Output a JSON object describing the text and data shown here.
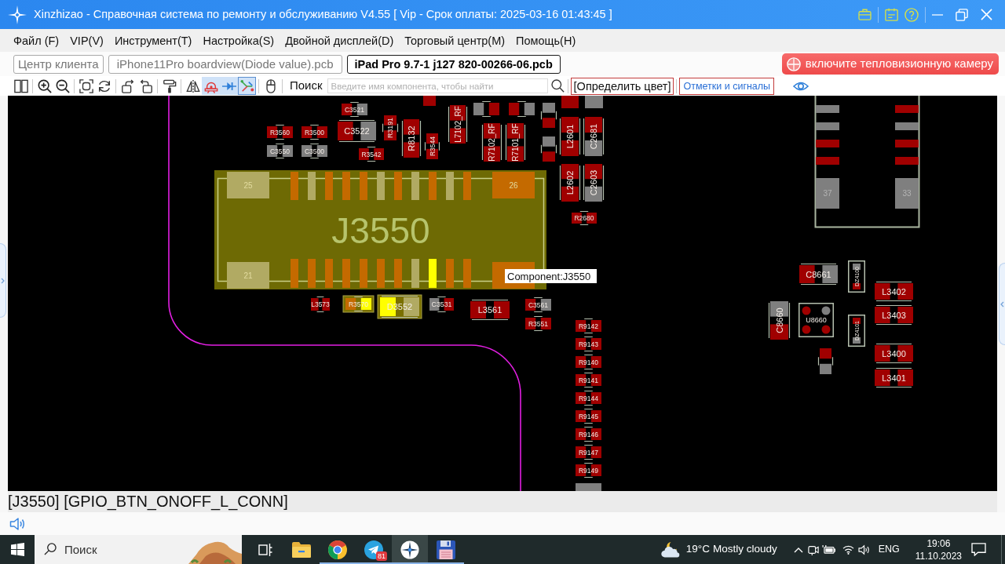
{
  "window": {
    "title": "Xinzhizao - Справочная система по ремонту и обслуживанию V4.55 [ Vip - Срок оплаты: 2025-03-16 01:43:45 ]"
  },
  "menu": [
    "Файл (F)",
    "VIP(V)",
    "Инструмент(T)",
    "Настройка(S)",
    "Двойной дисплей(D)",
    "Торговый центр(M)",
    "Помощь(H)"
  ],
  "tabs": [
    {
      "label": "Центр клиента",
      "selected": false
    },
    {
      "label": "iPhone11Pro boardview(Diode value).pcb",
      "selected": false
    },
    {
      "label": "iPad Pro 9.7-1 j127 820-00266-06.pcb",
      "selected": true
    }
  ],
  "thermal_button": "включите тепловизионную камеру",
  "toolbar": {
    "tools": [
      {
        "kind": "split",
        "active": false
      },
      {
        "kind": "zoom-in",
        "active": false
      },
      {
        "kind": "zoom-out",
        "active": false
      },
      {
        "kind": "fit",
        "active": false
      },
      {
        "kind": "refresh",
        "active": false
      },
      {
        "kind": "rotate-left",
        "active": false
      },
      {
        "kind": "rotate-right",
        "active": false
      },
      {
        "kind": "paint",
        "active": false
      },
      {
        "kind": "mirror",
        "active": false
      },
      {
        "kind": "alarm",
        "active": true
      },
      {
        "kind": "diode",
        "active": true
      },
      {
        "kind": "net",
        "active": true
      },
      {
        "kind": "mouse",
        "active": false
      }
    ],
    "search_label": "Поиск",
    "search": {
      "placeholder": "Введите имя компонента, чтобы найти"
    },
    "color_button": "[Определить цвет]",
    "marks_button": "Отметки и сигналы"
  },
  "board": {
    "connector": {
      "label": "J3550",
      "selected": true,
      "corner_pads": [
        {
          "label": "25",
          "color": "#b1aa63"
        },
        {
          "label": "26",
          "color": "#c46a00"
        },
        {
          "label": "21",
          "color": "#b1aa63"
        },
        {
          "color": "#c46a00"
        }
      ],
      "top_pins": [
        {
          "color": "#c46a00"
        },
        {
          "color": "#b1aa63"
        },
        {
          "color": "#c46a00"
        },
        {
          "color": "#c46a00"
        },
        {
          "color": "#c46a00"
        },
        {
          "color": "#b1aa63"
        },
        {
          "color": "#c46a00"
        },
        {
          "color": "#b1aa63"
        },
        {
          "color": "#c46a00"
        },
        {
          "color": "#b1aa63"
        },
        {
          "color": "#c46a00"
        }
      ],
      "bottom_pins": [
        {
          "color": "#c46a00"
        },
        {
          "color": "#c46a00"
        },
        {
          "color": "#c46a00"
        },
        {
          "color": "#c46a00"
        },
        {
          "color": "#c46a00"
        },
        {
          "color": "#c46a00"
        },
        {
          "color": "#c46a00"
        },
        {
          "color": "#b1aa63"
        },
        {
          "color": "#ffff00"
        },
        {
          "color": "#c46a00"
        },
        {
          "color": "#c46a00"
        }
      ]
    },
    "components": [
      {
        "kind": "two-pad",
        "highlighted": false,
        "pads": [
          {
            "color": "#a00000"
          }
        ]
      },
      {
        "kind": "two-pad",
        "label": "C3521",
        "highlighted": false,
        "pads": [
          {
            "color": "#a00000"
          },
          {
            "color": "#7f7f7f"
          }
        ]
      },
      {
        "kind": "two-pad",
        "label": "R3560",
        "highlighted": false,
        "pads": [
          {
            "color": "#a00000"
          },
          {
            "color": "#a00000"
          }
        ]
      },
      {
        "kind": "two-pad",
        "label": "R3500",
        "highlighted": false,
        "pads": [
          {
            "color": "#a00000"
          },
          {
            "color": "#a00000"
          }
        ]
      },
      {
        "kind": "two-pad",
        "label": "C3550",
        "highlighted": false,
        "pads": [
          {
            "color": "#7f7f7f"
          },
          {
            "color": "#7f7f7f"
          }
        ]
      },
      {
        "kind": "two-pad",
        "label": "C3500",
        "highlighted": false,
        "pads": [
          {
            "color": "#7f7f7f"
          },
          {
            "color": "#7f7f7f"
          }
        ]
      },
      {
        "kind": "two-pad",
        "label": "C3522",
        "highlighted": false,
        "pads": [
          {
            "color": "#a00000"
          },
          {
            "color": "#7f7f7f"
          }
        ]
      },
      {
        "kind": "two-pad",
        "label": "R3191",
        "highlighted": false,
        "pads": [
          {
            "color": "#a00000"
          },
          {
            "color": "#a00000"
          }
        ]
      },
      {
        "kind": "two-pad",
        "label": "R8132",
        "highlighted": false,
        "pads": [
          {
            "color": "#a00000"
          },
          {
            "color": "#a00000"
          }
        ]
      },
      {
        "kind": "two-pad",
        "label": "R3544",
        "highlighted": false,
        "pads": [
          {
            "color": "#a00000"
          },
          {
            "color": "#a00000"
          }
        ]
      },
      {
        "kind": "two-pad",
        "label": "R3542",
        "highlighted": false,
        "pads": [
          {
            "color": "#a00000"
          },
          {
            "color": "#a00000"
          }
        ]
      },
      {
        "kind": "two-pad",
        "label": "L7102_RF",
        "highlighted": false,
        "pads": [
          {
            "color": "#a00000"
          },
          {
            "color": "#a00000"
          }
        ]
      },
      {
        "kind": "two-pad",
        "highlighted": false,
        "pads": [
          {
            "color": "#7f7f7f"
          },
          {
            "color": "#a00000"
          }
        ]
      },
      {
        "kind": "two-pad",
        "highlighted": false,
        "pads": [
          {
            "color": "#a00000"
          },
          {
            "color": "#7f7f7f"
          }
        ]
      },
      {
        "kind": "two-pad",
        "label": "R7102_RF",
        "highlighted": false,
        "pads": [
          {
            "color": "#a00000"
          },
          {
            "color": "#a00000"
          }
        ]
      },
      {
        "kind": "two-pad",
        "label": "R7101_RF",
        "highlighted": false,
        "pads": [
          {
            "color": "#a00000"
          },
          {
            "color": "#a00000"
          }
        ]
      },
      {
        "kind": "two-pad",
        "highlighted": false,
        "pads": [
          {
            "color": "#7f7f7f"
          },
          {
            "color": "#a00000"
          }
        ]
      },
      {
        "kind": "two-pad",
        "highlighted": false,
        "pads": [
          {
            "color": "#7f7f7f"
          },
          {
            "color": "#a00000"
          }
        ]
      },
      {
        "kind": "two-pad",
        "highlighted": false,
        "pads": [
          {
            "color": "#a00000"
          }
        ]
      },
      {
        "kind": "two-pad",
        "highlighted": false,
        "pads": [
          {
            "color": "#7f7f7f"
          }
        ]
      },
      {
        "kind": "two-pad",
        "label": "L2601",
        "highlighted": false,
        "pads": [
          {
            "color": "#a00000"
          },
          {
            "color": "#a00000"
          }
        ]
      },
      {
        "kind": "two-pad",
        "label": "C2681",
        "highlighted": false,
        "pads": [
          {
            "color": "#a00000"
          },
          {
            "color": "#7f7f7f"
          }
        ]
      },
      {
        "kind": "two-pad",
        "label": "L2602",
        "highlighted": false,
        "pads": [
          {
            "color": "#a00000"
          },
          {
            "color": "#a00000"
          }
        ]
      },
      {
        "kind": "two-pad",
        "label": "C2603",
        "highlighted": false,
        "pads": [
          {
            "color": "#a00000"
          },
          {
            "color": "#7f7f7f"
          }
        ]
      },
      {
        "kind": "two-pad",
        "label": "R2680",
        "highlighted": false,
        "pads": [
          {
            "color": "#a00000"
          },
          {
            "color": "#a00000"
          }
        ]
      },
      {
        "kind": "two-pad",
        "label": "L3573",
        "highlighted": false,
        "pads": [
          {
            "color": "#a00000"
          },
          {
            "color": "#a00000"
          }
        ]
      },
      {
        "kind": "two-pad",
        "label": "R3570",
        "highlighted": true,
        "pads": [
          {
            "color": "#c46a00"
          },
          {
            "color": "#ffff00"
          }
        ]
      },
      {
        "kind": "two-pad",
        "label": "D3552",
        "highlighted": true,
        "pads": [
          {
            "color": "#ffff00"
          },
          {
            "color": "#b1aa63"
          }
        ]
      },
      {
        "kind": "two-pad",
        "label": "C3531",
        "highlighted": false,
        "pads": [
          {
            "color": "#7f7f7f"
          },
          {
            "color": "#a00000"
          }
        ]
      },
      {
        "kind": "two-pad",
        "label": "L3561",
        "highlighted": false,
        "pads": [
          {
            "color": "#a00000"
          },
          {
            "color": "#a00000"
          }
        ]
      },
      {
        "kind": "two-pad",
        "label": "C3561",
        "highlighted": false,
        "pads": [
          {
            "color": "#a00000"
          },
          {
            "color": "#7f7f7f"
          }
        ]
      },
      {
        "kind": "two-pad",
        "label": "R3551",
        "highlighted": false,
        "pads": [
          {
            "color": "#a00000"
          },
          {
            "color": "#a00000"
          }
        ]
      },
      {
        "kind": "two-pad",
        "label": "R9142",
        "highlighted": false,
        "pads": [
          {
            "color": "#a00000"
          },
          {
            "color": "#a00000"
          }
        ]
      },
      {
        "kind": "two-pad",
        "label": "R9143",
        "highlighted": false,
        "pads": [
          {
            "color": "#a00000"
          },
          {
            "color": "#a00000"
          }
        ]
      },
      {
        "kind": "two-pad",
        "label": "R9140",
        "highlighted": false,
        "pads": [
          {
            "color": "#a00000"
          },
          {
            "color": "#a00000"
          }
        ]
      },
      {
        "kind": "two-pad",
        "label": "R9141",
        "highlighted": false,
        "pads": [
          {
            "color": "#a00000"
          },
          {
            "color": "#a00000"
          }
        ]
      },
      {
        "kind": "two-pad",
        "label": "R9144",
        "highlighted": false,
        "pads": [
          {
            "color": "#a00000"
          },
          {
            "color": "#a00000"
          }
        ]
      },
      {
        "kind": "two-pad",
        "label": "R9145",
        "highlighted": false,
        "pads": [
          {
            "color": "#a00000"
          },
          {
            "color": "#a00000"
          }
        ]
      },
      {
        "kind": "two-pad",
        "label": "R9146",
        "highlighted": false,
        "pads": [
          {
            "color": "#a00000"
          },
          {
            "color": "#a00000"
          }
        ]
      },
      {
        "kind": "two-pad",
        "label": "R9147",
        "highlighted": false,
        "pads": [
          {
            "color": "#a00000"
          },
          {
            "color": "#a00000"
          }
        ]
      },
      {
        "kind": "two-pad",
        "label": "R9149",
        "highlighted": false,
        "pads": [
          {
            "color": "#a00000"
          },
          {
            "color": "#a00000"
          }
        ]
      },
      {
        "kind": "two-pad",
        "highlighted": false,
        "pads": [
          {
            "color": "#7f7f7f"
          }
        ]
      },
      {
        "kind": "two-pad",
        "label": "C8661",
        "highlighted": false,
        "pads": [
          {
            "color": "#a00000"
          },
          {
            "color": "#7f7f7f"
          }
        ]
      },
      {
        "kind": "boxed",
        "label": "DZ4100",
        "highlighted": false,
        "pads": [
          {
            "color": "#7f7f7f"
          },
          {
            "color": "#a00000"
          }
        ]
      },
      {
        "kind": "two-pad",
        "label": "L3402",
        "highlighted": false,
        "pads": [
          {
            "color": "#a00000"
          },
          {
            "color": "#a00000"
          }
        ]
      },
      {
        "kind": "two-pad",
        "label": "L3403",
        "highlighted": false,
        "pads": [
          {
            "color": "#a00000"
          },
          {
            "color": "#a00000"
          }
        ]
      },
      {
        "kind": "two-pad",
        "label": "C8660",
        "highlighted": false,
        "pads": [
          {
            "color": "#7f7f7f"
          },
          {
            "color": "#a00000"
          }
        ]
      },
      {
        "kind": "quad",
        "label": "U8660",
        "highlighted": false,
        "pads": [
          {
            "color": "#a00000"
          },
          {
            "color": "#7f7f7f"
          },
          {
            "color": "#a00000"
          },
          {
            "color": "#a00000"
          }
        ]
      },
      {
        "kind": "boxed",
        "label": "DZ4101",
        "highlighted": false,
        "pads": [
          {
            "color": "#a00000"
          },
          {
            "color": "#7f7f7f"
          }
        ]
      },
      {
        "kind": "two-pad",
        "highlighted": false,
        "pads": [
          {
            "color": "#a00000"
          },
          {
            "color": "#7f7f7f"
          }
        ]
      },
      {
        "kind": "two-pad",
        "label": "L3400",
        "highlighted": false,
        "pads": [
          {
            "color": "#a00000"
          },
          {
            "color": "#a00000"
          }
        ]
      },
      {
        "kind": "two-pad",
        "label": "L3401",
        "highlighted": false,
        "pads": [
          {
            "color": "#a00000"
          },
          {
            "color": "#a00000"
          }
        ]
      }
    ],
    "footprint": {
      "left_pads": [
        {
          "color": "#7f7f7f"
        },
        {
          "color": "#7f7f7f"
        },
        {
          "color": "#a00000"
        },
        {
          "color": "#a00000"
        }
      ],
      "right_pads": [
        {
          "color": "#a00000"
        },
        {
          "color": "#7f7f7f"
        },
        {
          "color": "#a00000"
        },
        {
          "color": "#a00000"
        }
      ],
      "end_pads": [
        {
          "label": "37",
          "color": "#7f7f7f"
        },
        {
          "label": "33",
          "color": "#7f7f7f"
        }
      ]
    },
    "tooltip": "Component:J3550"
  },
  "status_line": "[J3550] [GPIO_BTN_ONOFF_L_CONN]",
  "taskbar": {
    "search": {
      "placeholder": "Поиск"
    },
    "apps": [
      {
        "kind": "task-view",
        "running": false,
        "selected": false
      },
      {
        "kind": "folder",
        "running": false,
        "selected": false
      },
      {
        "kind": "chrome",
        "running": true,
        "selected": false
      },
      {
        "kind": "telegram",
        "running": true,
        "selected": false,
        "badge": "81"
      },
      {
        "kind": "boardview",
        "running": true,
        "selected": true
      },
      {
        "kind": "floppy",
        "running": true,
        "selected": false
      }
    ],
    "weather": {
      "temperature": "19°C",
      "condition": "Mostly cloudy"
    },
    "language": "ENG",
    "time": "19:06",
    "date": "11.10.2023"
  }
}
